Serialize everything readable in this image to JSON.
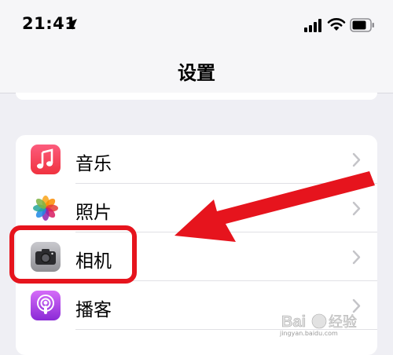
{
  "status": {
    "time": "21:41",
    "icons": [
      "location-arrow-icon",
      "signal-icon",
      "wifi-icon",
      "battery-icon"
    ]
  },
  "nav": {
    "title": "设置"
  },
  "settings": {
    "items": [
      {
        "label": "音乐",
        "icon": "music-icon"
      },
      {
        "label": "照片",
        "icon": "photos-icon"
      },
      {
        "label": "相机",
        "icon": "camera-icon"
      },
      {
        "label": "播客",
        "icon": "podcast-icon"
      }
    ]
  },
  "annotation": {
    "highlight_color": "#e6141d",
    "highlighted_item": "相机"
  },
  "watermark": {
    "brand": "Baidu经验",
    "url": "jingyan.baidu.com"
  }
}
